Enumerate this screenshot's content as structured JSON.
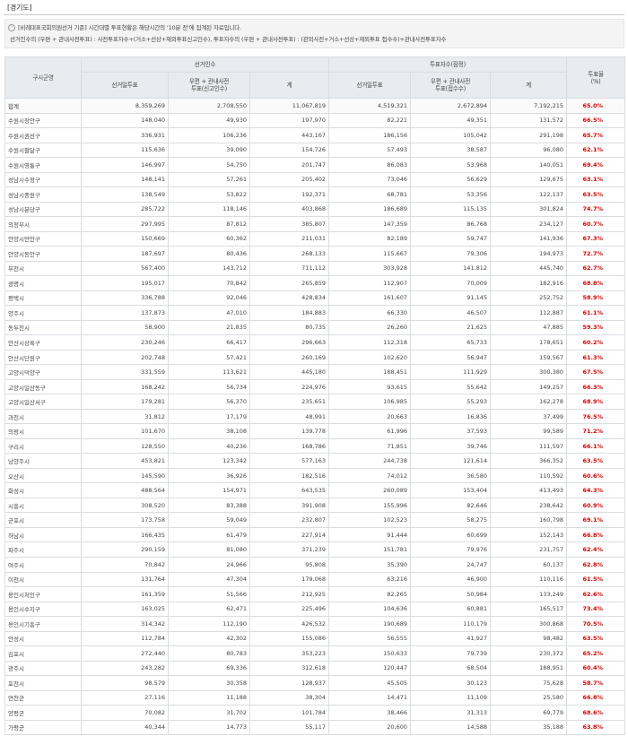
{
  "region_title": "[경기도]",
  "notice": {
    "line1": "[비례대표국회의원선거 기준] 시간대별 투표현황은 해당시간의 '10분 전'에 집계된 자료입니다.",
    "line2": "선거인수의 (우편 + 관내사전투표) : 사전투표자수+(거소+선상+재외투표신고인수), 투표자수의 (우편 + 관내사전투표) : (관외사전+거소+선상+재외투표 접수수)+관내사전투표자수"
  },
  "headers": {
    "district": "구시군명",
    "electors_group": "선거인수",
    "voters_group": "투표자수(잠정)",
    "rate": "투표율\n(%)",
    "election_day": "선거일투표",
    "postal_electors": "우편 + 관내사전\n투표(신고인수)",
    "postal_voters": "우편 + 관내사전\n투표(접수수)",
    "total": "계"
  },
  "rows": [
    [
      "합계",
      "8,359,269",
      "2,708,550",
      "11,067,819",
      "4,519,321",
      "2,672,894",
      "7,192,215",
      "65.0%"
    ],
    [
      "수원시장안구",
      "148,040",
      "49,930",
      "197,970",
      "82,221",
      "49,351",
      "131,572",
      "66.5%"
    ],
    [
      "수원시권선구",
      "336,931",
      "106,236",
      "443,167",
      "186,156",
      "105,042",
      "291,198",
      "65.7%"
    ],
    [
      "수원시팔달구",
      "115,636",
      "39,090",
      "154,726",
      "57,493",
      "38,587",
      "96,080",
      "62.1%"
    ],
    [
      "수원시영통구",
      "146,997",
      "54,750",
      "201,747",
      "86,083",
      "53,968",
      "140,051",
      "69.4%"
    ],
    [
      "성남시수정구",
      "148,141",
      "57,261",
      "205,402",
      "73,046",
      "56,629",
      "129,675",
      "63.1%"
    ],
    [
      "성남시중원구",
      "138,549",
      "53,822",
      "192,371",
      "68,781",
      "53,356",
      "122,137",
      "63.5%"
    ],
    [
      "성남시분당구",
      "285,722",
      "118,146",
      "403,868",
      "186,689",
      "115,135",
      "301,824",
      "74.7%"
    ],
    [
      "의정부시",
      "297,995",
      "87,812",
      "385,807",
      "147,359",
      "86,768",
      "234,127",
      "60.7%"
    ],
    [
      "안양시만안구",
      "150,669",
      "60,362",
      "211,031",
      "82,189",
      "59,747",
      "141,936",
      "67.3%"
    ],
    [
      "안양시동안구",
      "187,697",
      "80,436",
      "268,133",
      "115,667",
      "79,306",
      "194,973",
      "72.7%"
    ],
    [
      "부천시",
      "567,400",
      "143,712",
      "711,112",
      "303,928",
      "141,812",
      "445,740",
      "62.7%"
    ],
    [
      "광명시",
      "195,017",
      "70,842",
      "265,859",
      "112,907",
      "70,009",
      "182,916",
      "68.8%"
    ],
    [
      "평택시",
      "336,788",
      "92,046",
      "428,834",
      "161,607",
      "91,145",
      "252,752",
      "58.9%"
    ],
    [
      "양주시",
      "137,873",
      "47,010",
      "184,883",
      "66,330",
      "46,507",
      "112,887",
      "61.1%"
    ],
    [
      "동두천시",
      "58,900",
      "21,835",
      "80,735",
      "26,260",
      "21,625",
      "47,885",
      "59.3%"
    ],
    [
      "안산시상록구",
      "230,246",
      "66,417",
      "296,663",
      "112,318",
      "65,733",
      "178,651",
      "60.2%"
    ],
    [
      "안산시단원구",
      "202,748",
      "57,421",
      "260,169",
      "102,620",
      "56,947",
      "159,567",
      "61.3%"
    ],
    [
      "고양시덕양구",
      "331,559",
      "113,621",
      "445,180",
      "188,451",
      "111,929",
      "300,380",
      "67.5%"
    ],
    [
      "고양시일산동구",
      "168,242",
      "56,734",
      "224,976",
      "93,615",
      "55,642",
      "149,257",
      "66.3%"
    ],
    [
      "고양시일산서구",
      "179,281",
      "56,370",
      "235,651",
      "106,985",
      "55,293",
      "162,278",
      "68.9%"
    ],
    [
      "과천시",
      "31,812",
      "17,179",
      "48,991",
      "20,663",
      "16,836",
      "37,499",
      "76.5%"
    ],
    [
      "의왕시",
      "101,670",
      "38,108",
      "139,778",
      "61,996",
      "37,593",
      "99,589",
      "71.2%"
    ],
    [
      "구리시",
      "128,550",
      "40,236",
      "168,786",
      "71,851",
      "39,746",
      "111,597",
      "66.1%"
    ],
    [
      "남양주시",
      "453,821",
      "123,342",
      "577,163",
      "244,738",
      "121,614",
      "366,352",
      "63.5%"
    ],
    [
      "오산시",
      "145,590",
      "36,926",
      "182,516",
      "74,012",
      "36,580",
      "110,592",
      "60.6%"
    ],
    [
      "화성시",
      "488,564",
      "154,971",
      "643,535",
      "260,089",
      "153,404",
      "413,493",
      "64.3%"
    ],
    [
      "시흥시",
      "308,520",
      "83,388",
      "391,908",
      "155,996",
      "82,646",
      "238,642",
      "60.9%"
    ],
    [
      "군포시",
      "173,758",
      "59,049",
      "232,807",
      "102,523",
      "58,275",
      "160,798",
      "69.1%"
    ],
    [
      "하남시",
      "166,435",
      "61,479",
      "227,914",
      "91,444",
      "60,699",
      "152,143",
      "66.8%"
    ],
    [
      "파주시",
      "290,159",
      "81,080",
      "371,239",
      "151,781",
      "79,976",
      "231,757",
      "62.4%"
    ],
    [
      "여주시",
      "70,842",
      "24,966",
      "95,808",
      "35,390",
      "24,747",
      "60,137",
      "62.8%"
    ],
    [
      "이천시",
      "131,764",
      "47,304",
      "179,068",
      "63,216",
      "46,900",
      "110,116",
      "61.5%"
    ],
    [
      "용인시처인구",
      "161,359",
      "51,566",
      "212,925",
      "82,265",
      "50,984",
      "133,249",
      "62.6%"
    ],
    [
      "용인시수지구",
      "163,025",
      "62,471",
      "225,496",
      "104,636",
      "60,881",
      "165,517",
      "73.4%"
    ],
    [
      "용인시기흥구",
      "314,342",
      "112,190",
      "426,532",
      "190,689",
      "110,179",
      "300,868",
      "70.5%"
    ],
    [
      "안성시",
      "112,784",
      "42,302",
      "155,086",
      "56,555",
      "41,927",
      "98,482",
      "63.5%"
    ],
    [
      "김포시",
      "272,440",
      "80,783",
      "353,223",
      "150,633",
      "79,739",
      "230,372",
      "65.2%"
    ],
    [
      "광주시",
      "243,282",
      "69,336",
      "312,618",
      "120,447",
      "68,504",
      "188,951",
      "60.4%"
    ],
    [
      "포천시",
      "98,579",
      "30,358",
      "128,937",
      "45,505",
      "30,123",
      "75,628",
      "58.7%"
    ],
    [
      "연천군",
      "27,116",
      "11,188",
      "38,304",
      "14,471",
      "11,109",
      "25,580",
      "66.8%"
    ],
    [
      "양평군",
      "70,082",
      "31,702",
      "101,784",
      "38,466",
      "31,313",
      "69,779",
      "68.6%"
    ],
    [
      "가평군",
      "40,344",
      "14,773",
      "55,117",
      "20,600",
      "14,588",
      "35,188",
      "63.8%"
    ]
  ]
}
